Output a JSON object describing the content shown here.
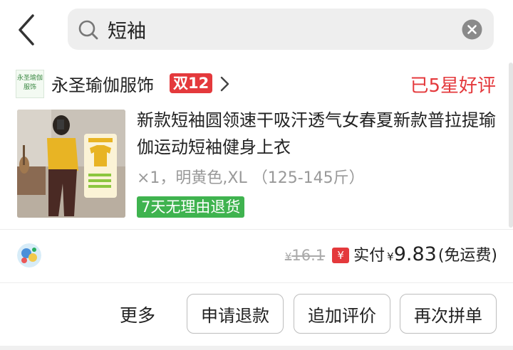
{
  "search": {
    "query": "短袖"
  },
  "store": {
    "logo_text": "永圣瑜伽服饰",
    "name": "永圣瑜伽服饰",
    "promo_badge": "双12",
    "review_status": "已5星好评"
  },
  "order": {
    "product_title": "新款短袖圆领速干吸汗透气女春夏新款普拉提瑜伽运动短袖健身上衣",
    "spec": "×1，明黄色,XL （125-145斤）",
    "return_policy": "7天无理由退货",
    "image_color": "#e8b424"
  },
  "price": {
    "currency": "¥",
    "original": "16.1",
    "coupon_glyph": "¥",
    "paid_label": "实付",
    "paid_amount": "9.83",
    "shipping_note": "(免运费)"
  },
  "actions": {
    "more": "更多",
    "refund": "申请退款",
    "add_review": "追加评价",
    "reorder": "再次拼单"
  },
  "colors": {
    "accent_red": "#e4393c",
    "return_green": "#3fb34f",
    "search_bg": "#eeeeee"
  },
  "icons": {
    "back": "chevron-left-icon",
    "search": "search-icon",
    "clear": "clear-icon",
    "store_chevron": "chevron-right-icon",
    "coupon": "coupon-icon"
  }
}
